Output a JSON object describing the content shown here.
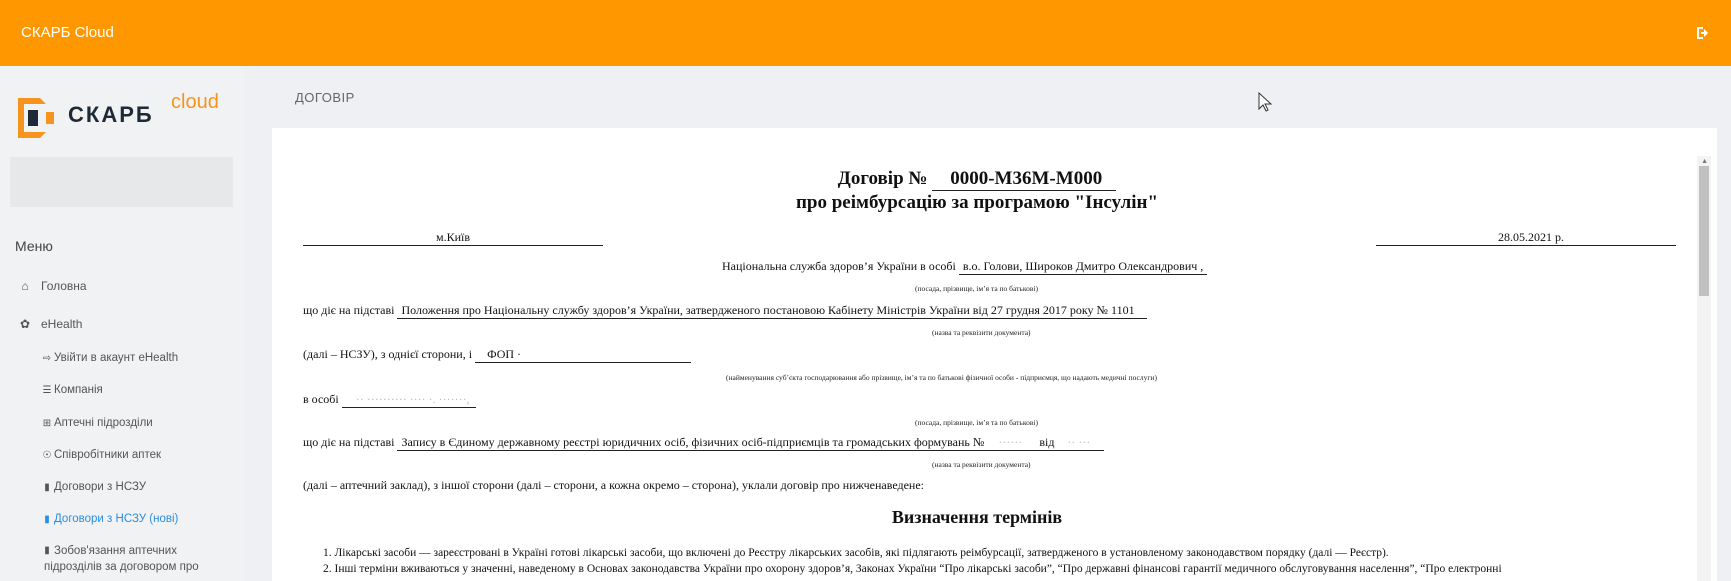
{
  "header": {
    "app_title": "СКАРБ Cloud",
    "logout_icon": "sign-out-icon"
  },
  "sidebar": {
    "logo": {
      "brand": "СКАРБ",
      "brand_sup": "cloud"
    },
    "menu_title": "Меню",
    "items": [
      {
        "label": "Головна",
        "icon": "home-icon"
      },
      {
        "label": "eHealth",
        "icon": "leaf-icon"
      }
    ],
    "subitems": [
      {
        "label": "Увійти в акаунт eHealth",
        "icon": "sign-in-icon"
      },
      {
        "label": "Компанія",
        "icon": "database-icon"
      },
      {
        "label": "Аптечні підрозділи",
        "icon": "plus-square-icon"
      },
      {
        "label": "Співробітники аптек",
        "icon": "sitemap-icon"
      },
      {
        "label": "Договори з НСЗУ",
        "icon": "file-icon"
      },
      {
        "label": "Договори з НСЗУ (нові)",
        "icon": "file-icon",
        "active": true
      },
      {
        "label": "Зобов'язання аптечних",
        "label2": "підрозділів за договором про",
        "icon": "file-icon"
      }
    ],
    "active_color": "#2a8de0"
  },
  "content": {
    "title": "ДОГОВІР"
  },
  "document": {
    "title_prefix": "Договір №",
    "number": "0000-M36M-M000",
    "subtitle": "про реімбурсацію за програмою \"Інсулін\"",
    "city": "м.Київ",
    "date": "28.05.2021 р.",
    "nhsu_prefix": "Національна служба здоров’я України в особі",
    "nhsu_person": "в.о. Голови, Широков Дмитро Олександрович ,",
    "hint_position": "(посада, прізвище, ім’я та по батькові)",
    "basis_prefix": "що діє на підставі",
    "basis_nhsu": "Положення про Національну службу здоров’я України, затвердженого постановою Кабінету Міністрів України від 27 грудня 2017 року № 1101",
    "hint_document": "(назва та реквізити документа)",
    "party_prefix": "(далі – НСЗУ), з однієї сторони, і",
    "party_name": "ФОП ·",
    "hint_party": "(найменування суб’єкта господарювання або прізвище, ім’я та по батькові фізичної особи - підприємця, що надають медичні послуги)",
    "person_prefix": "в особі",
    "person_name": "·· ·········· ···· ·. ·······,",
    "hint_position2": "(посада, прізвище, ім’я та по батькові)",
    "basis_prefix2": "що діє на підставі",
    "basis_pharmacy": "Запису в Єдиному державному реєстрі юридичних осіб, фізичних осіб-підприємців та громадських формувань №",
    "basis_pharmacy_num": "······",
    "basis_pharmacy_from": "від",
    "basis_pharmacy_date": "·· ···",
    "hint_document2": "(назва та реквізити документа)",
    "parties_text": "(далі – аптечний заклад), з іншої сторони (далі – сторони, а кожна окремо – сторона), уклали договір про нижченаведене:",
    "section_title": "Визначення термінів",
    "terms": [
      "1. Лікарські засоби — зареєстровані в Україні готові лікарські засоби, що включені до Реєстру лікарських засобів, які підлягають реімбурсації, затвердженого в установленому законодавством порядку (далі — Реєстр).",
      "2. Інші терміни вживаються у значенні, наведеному в Основах законодавства України про охорону здоров’я, Законах України “Про лікарські засоби”, “Про державні фінансові гарантії медичного обслуговування населення”, “Про електронні"
    ]
  }
}
